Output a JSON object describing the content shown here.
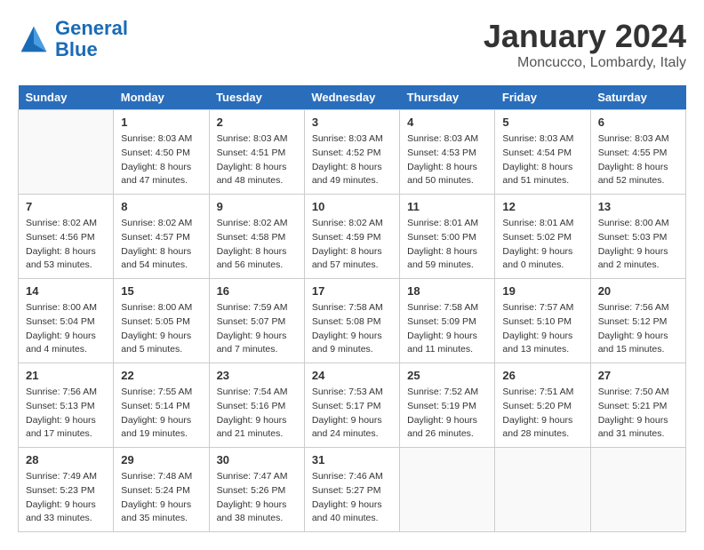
{
  "header": {
    "logo_line1": "General",
    "logo_line2": "Blue",
    "month_title": "January 2024",
    "location": "Moncucco, Lombardy, Italy"
  },
  "weekdays": [
    "Sunday",
    "Monday",
    "Tuesday",
    "Wednesday",
    "Thursday",
    "Friday",
    "Saturday"
  ],
  "weeks": [
    [
      {
        "day": "",
        "info": ""
      },
      {
        "day": "1",
        "info": "Sunrise: 8:03 AM\nSunset: 4:50 PM\nDaylight: 8 hours\nand 47 minutes."
      },
      {
        "day": "2",
        "info": "Sunrise: 8:03 AM\nSunset: 4:51 PM\nDaylight: 8 hours\nand 48 minutes."
      },
      {
        "day": "3",
        "info": "Sunrise: 8:03 AM\nSunset: 4:52 PM\nDaylight: 8 hours\nand 49 minutes."
      },
      {
        "day": "4",
        "info": "Sunrise: 8:03 AM\nSunset: 4:53 PM\nDaylight: 8 hours\nand 50 minutes."
      },
      {
        "day": "5",
        "info": "Sunrise: 8:03 AM\nSunset: 4:54 PM\nDaylight: 8 hours\nand 51 minutes."
      },
      {
        "day": "6",
        "info": "Sunrise: 8:03 AM\nSunset: 4:55 PM\nDaylight: 8 hours\nand 52 minutes."
      }
    ],
    [
      {
        "day": "7",
        "info": "Sunrise: 8:02 AM\nSunset: 4:56 PM\nDaylight: 8 hours\nand 53 minutes."
      },
      {
        "day": "8",
        "info": "Sunrise: 8:02 AM\nSunset: 4:57 PM\nDaylight: 8 hours\nand 54 minutes."
      },
      {
        "day": "9",
        "info": "Sunrise: 8:02 AM\nSunset: 4:58 PM\nDaylight: 8 hours\nand 56 minutes."
      },
      {
        "day": "10",
        "info": "Sunrise: 8:02 AM\nSunset: 4:59 PM\nDaylight: 8 hours\nand 57 minutes."
      },
      {
        "day": "11",
        "info": "Sunrise: 8:01 AM\nSunset: 5:00 PM\nDaylight: 8 hours\nand 59 minutes."
      },
      {
        "day": "12",
        "info": "Sunrise: 8:01 AM\nSunset: 5:02 PM\nDaylight: 9 hours\nand 0 minutes."
      },
      {
        "day": "13",
        "info": "Sunrise: 8:00 AM\nSunset: 5:03 PM\nDaylight: 9 hours\nand 2 minutes."
      }
    ],
    [
      {
        "day": "14",
        "info": "Sunrise: 8:00 AM\nSunset: 5:04 PM\nDaylight: 9 hours\nand 4 minutes."
      },
      {
        "day": "15",
        "info": "Sunrise: 8:00 AM\nSunset: 5:05 PM\nDaylight: 9 hours\nand 5 minutes."
      },
      {
        "day": "16",
        "info": "Sunrise: 7:59 AM\nSunset: 5:07 PM\nDaylight: 9 hours\nand 7 minutes."
      },
      {
        "day": "17",
        "info": "Sunrise: 7:58 AM\nSunset: 5:08 PM\nDaylight: 9 hours\nand 9 minutes."
      },
      {
        "day": "18",
        "info": "Sunrise: 7:58 AM\nSunset: 5:09 PM\nDaylight: 9 hours\nand 11 minutes."
      },
      {
        "day": "19",
        "info": "Sunrise: 7:57 AM\nSunset: 5:10 PM\nDaylight: 9 hours\nand 13 minutes."
      },
      {
        "day": "20",
        "info": "Sunrise: 7:56 AM\nSunset: 5:12 PM\nDaylight: 9 hours\nand 15 minutes."
      }
    ],
    [
      {
        "day": "21",
        "info": "Sunrise: 7:56 AM\nSunset: 5:13 PM\nDaylight: 9 hours\nand 17 minutes."
      },
      {
        "day": "22",
        "info": "Sunrise: 7:55 AM\nSunset: 5:14 PM\nDaylight: 9 hours\nand 19 minutes."
      },
      {
        "day": "23",
        "info": "Sunrise: 7:54 AM\nSunset: 5:16 PM\nDaylight: 9 hours\nand 21 minutes."
      },
      {
        "day": "24",
        "info": "Sunrise: 7:53 AM\nSunset: 5:17 PM\nDaylight: 9 hours\nand 24 minutes."
      },
      {
        "day": "25",
        "info": "Sunrise: 7:52 AM\nSunset: 5:19 PM\nDaylight: 9 hours\nand 26 minutes."
      },
      {
        "day": "26",
        "info": "Sunrise: 7:51 AM\nSunset: 5:20 PM\nDaylight: 9 hours\nand 28 minutes."
      },
      {
        "day": "27",
        "info": "Sunrise: 7:50 AM\nSunset: 5:21 PM\nDaylight: 9 hours\nand 31 minutes."
      }
    ],
    [
      {
        "day": "28",
        "info": "Sunrise: 7:49 AM\nSunset: 5:23 PM\nDaylight: 9 hours\nand 33 minutes."
      },
      {
        "day": "29",
        "info": "Sunrise: 7:48 AM\nSunset: 5:24 PM\nDaylight: 9 hours\nand 35 minutes."
      },
      {
        "day": "30",
        "info": "Sunrise: 7:47 AM\nSunset: 5:26 PM\nDaylight: 9 hours\nand 38 minutes."
      },
      {
        "day": "31",
        "info": "Sunrise: 7:46 AM\nSunset: 5:27 PM\nDaylight: 9 hours\nand 40 minutes."
      },
      {
        "day": "",
        "info": ""
      },
      {
        "day": "",
        "info": ""
      },
      {
        "day": "",
        "info": ""
      }
    ]
  ]
}
